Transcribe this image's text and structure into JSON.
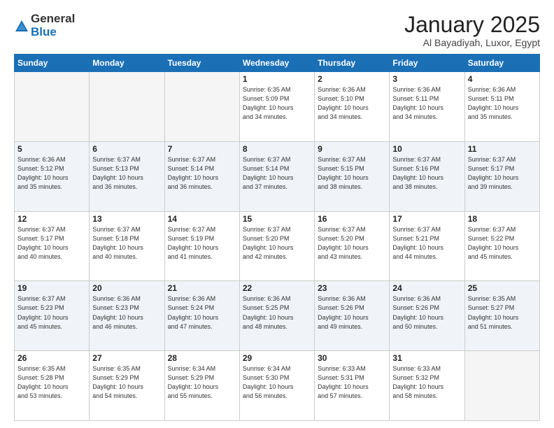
{
  "logo": {
    "general": "General",
    "blue": "Blue"
  },
  "header": {
    "month": "January 2025",
    "location": "Al Bayadiyah, Luxor, Egypt"
  },
  "weekdays": [
    "Sunday",
    "Monday",
    "Tuesday",
    "Wednesday",
    "Thursday",
    "Friday",
    "Saturday"
  ],
  "weeks": [
    {
      "shade": false,
      "days": [
        {
          "num": "",
          "info": ""
        },
        {
          "num": "",
          "info": ""
        },
        {
          "num": "",
          "info": ""
        },
        {
          "num": "1",
          "info": "Sunrise: 6:35 AM\nSunset: 5:09 PM\nDaylight: 10 hours\nand 34 minutes."
        },
        {
          "num": "2",
          "info": "Sunrise: 6:36 AM\nSunset: 5:10 PM\nDaylight: 10 hours\nand 34 minutes."
        },
        {
          "num": "3",
          "info": "Sunrise: 6:36 AM\nSunset: 5:11 PM\nDaylight: 10 hours\nand 34 minutes."
        },
        {
          "num": "4",
          "info": "Sunrise: 6:36 AM\nSunset: 5:11 PM\nDaylight: 10 hours\nand 35 minutes."
        }
      ]
    },
    {
      "shade": true,
      "days": [
        {
          "num": "5",
          "info": "Sunrise: 6:36 AM\nSunset: 5:12 PM\nDaylight: 10 hours\nand 35 minutes."
        },
        {
          "num": "6",
          "info": "Sunrise: 6:37 AM\nSunset: 5:13 PM\nDaylight: 10 hours\nand 36 minutes."
        },
        {
          "num": "7",
          "info": "Sunrise: 6:37 AM\nSunset: 5:14 PM\nDaylight: 10 hours\nand 36 minutes."
        },
        {
          "num": "8",
          "info": "Sunrise: 6:37 AM\nSunset: 5:14 PM\nDaylight: 10 hours\nand 37 minutes."
        },
        {
          "num": "9",
          "info": "Sunrise: 6:37 AM\nSunset: 5:15 PM\nDaylight: 10 hours\nand 38 minutes."
        },
        {
          "num": "10",
          "info": "Sunrise: 6:37 AM\nSunset: 5:16 PM\nDaylight: 10 hours\nand 38 minutes."
        },
        {
          "num": "11",
          "info": "Sunrise: 6:37 AM\nSunset: 5:17 PM\nDaylight: 10 hours\nand 39 minutes."
        }
      ]
    },
    {
      "shade": false,
      "days": [
        {
          "num": "12",
          "info": "Sunrise: 6:37 AM\nSunset: 5:17 PM\nDaylight: 10 hours\nand 40 minutes."
        },
        {
          "num": "13",
          "info": "Sunrise: 6:37 AM\nSunset: 5:18 PM\nDaylight: 10 hours\nand 40 minutes."
        },
        {
          "num": "14",
          "info": "Sunrise: 6:37 AM\nSunset: 5:19 PM\nDaylight: 10 hours\nand 41 minutes."
        },
        {
          "num": "15",
          "info": "Sunrise: 6:37 AM\nSunset: 5:20 PM\nDaylight: 10 hours\nand 42 minutes."
        },
        {
          "num": "16",
          "info": "Sunrise: 6:37 AM\nSunset: 5:20 PM\nDaylight: 10 hours\nand 43 minutes."
        },
        {
          "num": "17",
          "info": "Sunrise: 6:37 AM\nSunset: 5:21 PM\nDaylight: 10 hours\nand 44 minutes."
        },
        {
          "num": "18",
          "info": "Sunrise: 6:37 AM\nSunset: 5:22 PM\nDaylight: 10 hours\nand 45 minutes."
        }
      ]
    },
    {
      "shade": true,
      "days": [
        {
          "num": "19",
          "info": "Sunrise: 6:37 AM\nSunset: 5:23 PM\nDaylight: 10 hours\nand 45 minutes."
        },
        {
          "num": "20",
          "info": "Sunrise: 6:36 AM\nSunset: 5:23 PM\nDaylight: 10 hours\nand 46 minutes."
        },
        {
          "num": "21",
          "info": "Sunrise: 6:36 AM\nSunset: 5:24 PM\nDaylight: 10 hours\nand 47 minutes."
        },
        {
          "num": "22",
          "info": "Sunrise: 6:36 AM\nSunset: 5:25 PM\nDaylight: 10 hours\nand 48 minutes."
        },
        {
          "num": "23",
          "info": "Sunrise: 6:36 AM\nSunset: 5:26 PM\nDaylight: 10 hours\nand 49 minutes."
        },
        {
          "num": "24",
          "info": "Sunrise: 6:36 AM\nSunset: 5:26 PM\nDaylight: 10 hours\nand 50 minutes."
        },
        {
          "num": "25",
          "info": "Sunrise: 6:35 AM\nSunset: 5:27 PM\nDaylight: 10 hours\nand 51 minutes."
        }
      ]
    },
    {
      "shade": false,
      "days": [
        {
          "num": "26",
          "info": "Sunrise: 6:35 AM\nSunset: 5:28 PM\nDaylight: 10 hours\nand 53 minutes."
        },
        {
          "num": "27",
          "info": "Sunrise: 6:35 AM\nSunset: 5:29 PM\nDaylight: 10 hours\nand 54 minutes."
        },
        {
          "num": "28",
          "info": "Sunrise: 6:34 AM\nSunset: 5:29 PM\nDaylight: 10 hours\nand 55 minutes."
        },
        {
          "num": "29",
          "info": "Sunrise: 6:34 AM\nSunset: 5:30 PM\nDaylight: 10 hours\nand 56 minutes."
        },
        {
          "num": "30",
          "info": "Sunrise: 6:33 AM\nSunset: 5:31 PM\nDaylight: 10 hours\nand 57 minutes."
        },
        {
          "num": "31",
          "info": "Sunrise: 6:33 AM\nSunset: 5:32 PM\nDaylight: 10 hours\nand 58 minutes."
        },
        {
          "num": "",
          "info": ""
        }
      ]
    }
  ]
}
